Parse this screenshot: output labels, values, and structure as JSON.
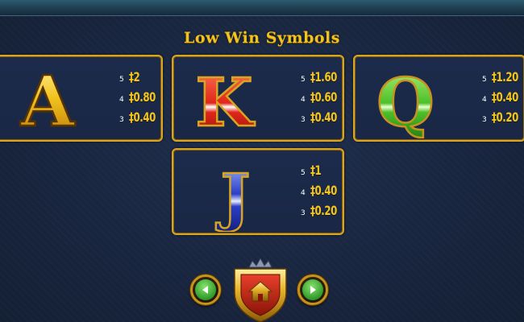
{
  "title": "Low Win Symbols",
  "colors": {
    "accent_gold": "#f2c21e",
    "background": "#1a2842",
    "card_border": "#d9a520",
    "nav_green": "#2f9a2a"
  },
  "symbols": [
    {
      "letter": "A",
      "color": "gold",
      "pays": [
        {
          "count": "5",
          "value": "‡2"
        },
        {
          "count": "4",
          "value": "‡0.80"
        },
        {
          "count": "3",
          "value": "‡0.40"
        }
      ]
    },
    {
      "letter": "K",
      "color": "red",
      "pays": [
        {
          "count": "5",
          "value": "‡1.60"
        },
        {
          "count": "4",
          "value": "‡0.60"
        },
        {
          "count": "3",
          "value": "‡0.40"
        }
      ]
    },
    {
      "letter": "Q",
      "color": "green",
      "pays": [
        {
          "count": "5",
          "value": "‡1.20"
        },
        {
          "count": "4",
          "value": "‡0.40"
        },
        {
          "count": "3",
          "value": "‡0.20"
        }
      ]
    },
    {
      "letter": "J",
      "color": "blue",
      "pays": [
        {
          "count": "5",
          "value": "‡1"
        },
        {
          "count": "4",
          "value": "‡0.40"
        },
        {
          "count": "3",
          "value": "‡0.20"
        }
      ]
    }
  ],
  "nav": {
    "prev_icon": "arrow-left-icon",
    "home_icon": "home-icon",
    "next_icon": "arrow-right-icon"
  }
}
